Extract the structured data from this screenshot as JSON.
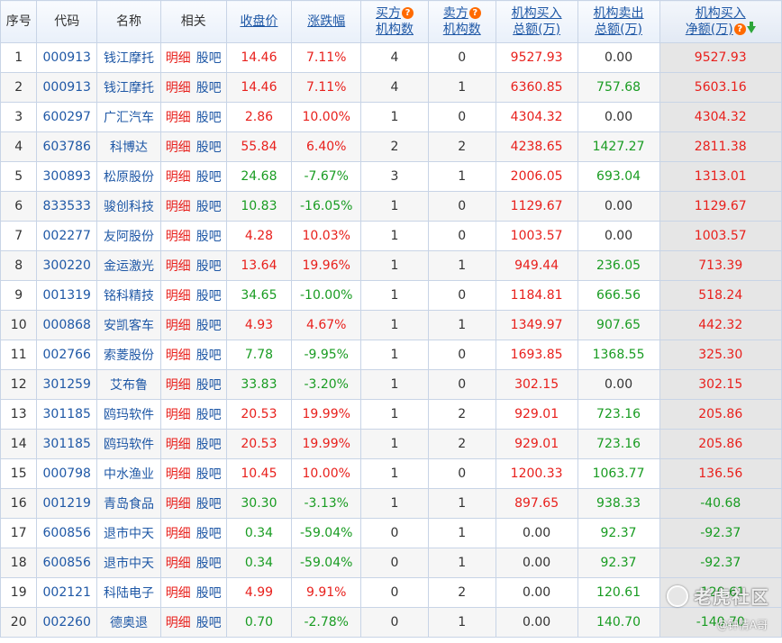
{
  "header": {
    "seq": "序号",
    "code": "代码",
    "name": "名称",
    "related": "相关",
    "close": "收盘价",
    "change": "涨跌幅",
    "buy_count_1": "买方",
    "buy_count_2": "机构数",
    "sell_count_1": "卖方",
    "sell_count_2": "机构数",
    "buy_total_1": "机构买入",
    "buy_total_2": "总额(万)",
    "sell_total_1": "机构卖出",
    "sell_total_2": "总额(万)",
    "net_1": "机构买入",
    "net_2": "净额(万)",
    "help_glyph": "?"
  },
  "related_labels": {
    "detail": "明细",
    "forum": "股吧"
  },
  "colors": {
    "up": "#e8201c",
    "down": "#199c22",
    "link": "#1f58a6",
    "help": "#ff6a00"
  },
  "rows": [
    {
      "seq": "1",
      "code": "000913",
      "name": "钱江摩托",
      "close": "14.46",
      "change": "7.11%",
      "buy_n": "4",
      "sell_n": "0",
      "buy_amt": "9527.93",
      "sell_amt": "0.00",
      "net": "9527.93",
      "dir": "up"
    },
    {
      "seq": "2",
      "code": "000913",
      "name": "钱江摩托",
      "close": "14.46",
      "change": "7.11%",
      "buy_n": "4",
      "sell_n": "1",
      "buy_amt": "6360.85",
      "sell_amt": "757.68",
      "net": "5603.16",
      "dir": "up"
    },
    {
      "seq": "3",
      "code": "600297",
      "name": "广汇汽车",
      "close": "2.86",
      "change": "10.00%",
      "buy_n": "1",
      "sell_n": "0",
      "buy_amt": "4304.32",
      "sell_amt": "0.00",
      "net": "4304.32",
      "dir": "up"
    },
    {
      "seq": "4",
      "code": "603786",
      "name": "科博达",
      "close": "55.84",
      "change": "6.40%",
      "buy_n": "2",
      "sell_n": "2",
      "buy_amt": "4238.65",
      "sell_amt": "1427.27",
      "net": "2811.38",
      "dir": "up"
    },
    {
      "seq": "5",
      "code": "300893",
      "name": "松原股份",
      "close": "24.68",
      "change": "-7.67%",
      "buy_n": "3",
      "sell_n": "1",
      "buy_amt": "2006.05",
      "sell_amt": "693.04",
      "net": "1313.01",
      "dir": "down"
    },
    {
      "seq": "6",
      "code": "833533",
      "name": "骏创科技",
      "close": "10.83",
      "change": "-16.05%",
      "buy_n": "1",
      "sell_n": "0",
      "buy_amt": "1129.67",
      "sell_amt": "0.00",
      "net": "1129.67",
      "dir": "down"
    },
    {
      "seq": "7",
      "code": "002277",
      "name": "友阿股份",
      "close": "4.28",
      "change": "10.03%",
      "buy_n": "1",
      "sell_n": "0",
      "buy_amt": "1003.57",
      "sell_amt": "0.00",
      "net": "1003.57",
      "dir": "up"
    },
    {
      "seq": "8",
      "code": "300220",
      "name": "金运激光",
      "close": "13.64",
      "change": "19.96%",
      "buy_n": "1",
      "sell_n": "1",
      "buy_amt": "949.44",
      "sell_amt": "236.05",
      "net": "713.39",
      "dir": "up"
    },
    {
      "seq": "9",
      "code": "001319",
      "name": "铭科精技",
      "close": "34.65",
      "change": "-10.00%",
      "buy_n": "1",
      "sell_n": "0",
      "buy_amt": "1184.81",
      "sell_amt": "666.56",
      "net": "518.24",
      "dir": "down"
    },
    {
      "seq": "10",
      "code": "000868",
      "name": "安凯客车",
      "close": "4.93",
      "change": "4.67%",
      "buy_n": "1",
      "sell_n": "1",
      "buy_amt": "1349.97",
      "sell_amt": "907.65",
      "net": "442.32",
      "dir": "up"
    },
    {
      "seq": "11",
      "code": "002766",
      "name": "索菱股份",
      "close": "7.78",
      "change": "-9.95%",
      "buy_n": "1",
      "sell_n": "0",
      "buy_amt": "1693.85",
      "sell_amt": "1368.55",
      "net": "325.30",
      "dir": "down"
    },
    {
      "seq": "12",
      "code": "301259",
      "name": "艾布鲁",
      "close": "33.83",
      "change": "-3.20%",
      "buy_n": "1",
      "sell_n": "0",
      "buy_amt": "302.15",
      "sell_amt": "0.00",
      "net": "302.15",
      "dir": "down"
    },
    {
      "seq": "13",
      "code": "301185",
      "name": "鸥玛软件",
      "close": "20.53",
      "change": "19.99%",
      "buy_n": "1",
      "sell_n": "2",
      "buy_amt": "929.01",
      "sell_amt": "723.16",
      "net": "205.86",
      "dir": "up"
    },
    {
      "seq": "14",
      "code": "301185",
      "name": "鸥玛软件",
      "close": "20.53",
      "change": "19.99%",
      "buy_n": "1",
      "sell_n": "2",
      "buy_amt": "929.01",
      "sell_amt": "723.16",
      "net": "205.86",
      "dir": "up"
    },
    {
      "seq": "15",
      "code": "000798",
      "name": "中水渔业",
      "close": "10.45",
      "change": "10.00%",
      "buy_n": "1",
      "sell_n": "0",
      "buy_amt": "1200.33",
      "sell_amt": "1063.77",
      "net": "136.56",
      "dir": "up"
    },
    {
      "seq": "16",
      "code": "001219",
      "name": "青岛食品",
      "close": "30.30",
      "change": "-3.13%",
      "buy_n": "1",
      "sell_n": "1",
      "buy_amt": "897.65",
      "sell_amt": "938.33",
      "net": "-40.68",
      "dir": "down"
    },
    {
      "seq": "17",
      "code": "600856",
      "name": "退市中天",
      "close": "0.34",
      "change": "-59.04%",
      "buy_n": "0",
      "sell_n": "1",
      "buy_amt": "0.00",
      "sell_amt": "92.37",
      "net": "-92.37",
      "dir": "down"
    },
    {
      "seq": "18",
      "code": "600856",
      "name": "退市中天",
      "close": "0.34",
      "change": "-59.04%",
      "buy_n": "0",
      "sell_n": "1",
      "buy_amt": "0.00",
      "sell_amt": "92.37",
      "net": "-92.37",
      "dir": "down"
    },
    {
      "seq": "19",
      "code": "002121",
      "name": "科陆电子",
      "close": "4.99",
      "change": "9.91%",
      "buy_n": "0",
      "sell_n": "2",
      "buy_amt": "0.00",
      "sell_amt": "120.61",
      "net": "-120.61",
      "dir": "up"
    },
    {
      "seq": "20",
      "code": "002260",
      "name": "德奥退",
      "close": "0.70",
      "change": "-2.78%",
      "buy_n": "0",
      "sell_n": "1",
      "buy_amt": "0.00",
      "sell_amt": "140.70",
      "net": "-140.70",
      "dir": "down"
    }
  ],
  "watermark": {
    "title": "老虎社区",
    "sub": "@钟情A哥"
  }
}
